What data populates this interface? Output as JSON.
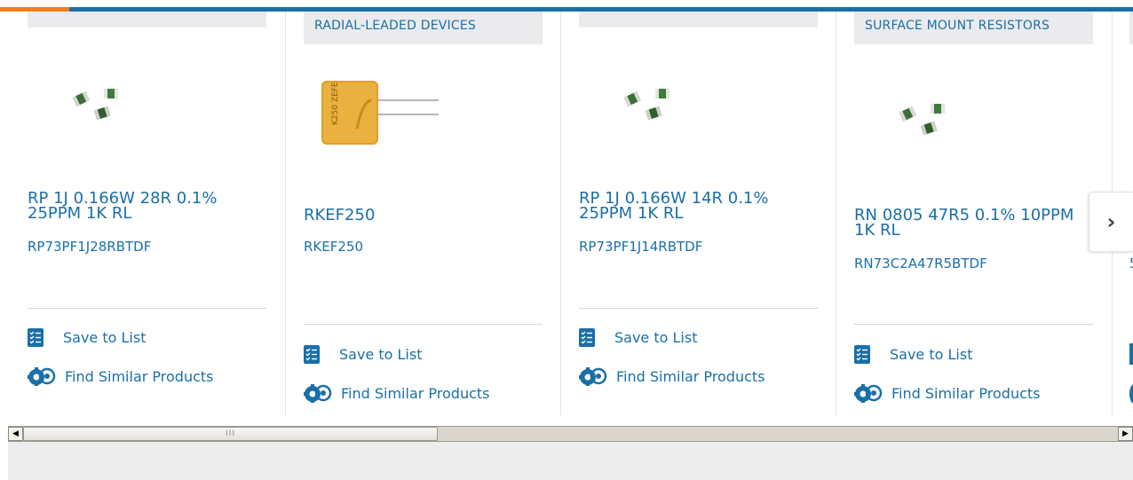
{
  "carousel": {
    "cards": [
      {
        "category": "",
        "title": "RP 1J 0.166W 28R 0.1% 25PPM 1K RL",
        "part_number": "RP73PF1J28RBTDF",
        "save_label": "Save to List",
        "similar_label": "Find Similar Products",
        "image": "chip-resistors-image"
      },
      {
        "category": "RADIAL-LEADED DEVICES",
        "title": "RKEF250",
        "part_number": "RKEF250",
        "save_label": "Save to List",
        "similar_label": "Find Similar Products",
        "image": "radial-ptc-fuse-image",
        "image_marking": "K250 ZEFE"
      },
      {
        "category": "",
        "title": "RP 1J 0.166W 14R 0.1% 25PPM 1K RL",
        "part_number": "RP73PF1J14RBTDF",
        "save_label": "Save to List",
        "similar_label": "Find Similar Products",
        "image": "chip-resistors-image"
      },
      {
        "category": "SURFACE MOUNT RESISTORS",
        "title": "RN 0805 47R5 0.1% 10PPM 1K RL",
        "part_number": "RN73C2A47R5BTDF",
        "save_label": "Save to List",
        "similar_label": "Find Similar Products",
        "image": "chip-resistors-image"
      },
      {
        "partial_text": "5"
      }
    ],
    "next_label": "›"
  },
  "scrollbar": {
    "left_arrow": "◀",
    "right_arrow": "▶",
    "thumb_grip": "III",
    "position_fraction": 0.0
  },
  "colors": {
    "brand_blue": "#1a6fa8",
    "accent_orange": "#f07f1b",
    "category_bg": "#ebebed"
  }
}
